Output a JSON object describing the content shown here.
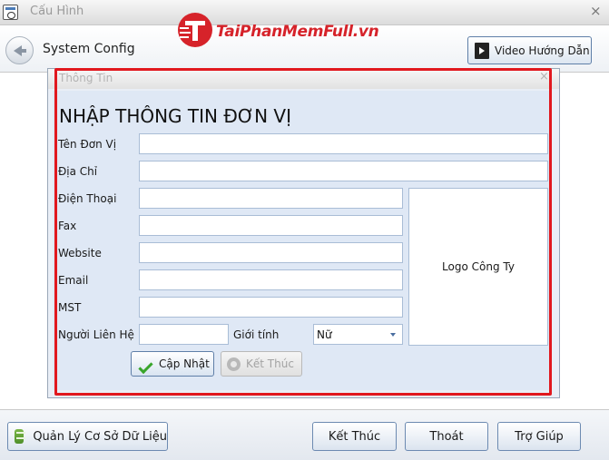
{
  "window": {
    "title": "Cấu Hình",
    "close_glyph": "×"
  },
  "toolbar": {
    "title": "System Config",
    "video_button_label": "Video Hướng Dẫn",
    "back_icon": "back-arrow-icon",
    "video_icon": "video-clapper-icon"
  },
  "watermark": {
    "text": "TaiPhanMemFull.vn",
    "color": "#d6232a"
  },
  "dialog": {
    "title": "Thông Tin",
    "close_glyph": "×",
    "heading": "NHẬP THÔNG TIN ĐƠN VỊ",
    "fields": {
      "ten_don_vi": {
        "label": "Tên Đơn Vị",
        "value": ""
      },
      "dia_chi": {
        "label": "Địa Chỉ",
        "value": ""
      },
      "dien_thoai": {
        "label": "Điện Thoại",
        "value": ""
      },
      "fax": {
        "label": "Fax",
        "value": ""
      },
      "website": {
        "label": "Website",
        "value": ""
      },
      "email": {
        "label": "Email",
        "value": ""
      },
      "mst": {
        "label": "MST",
        "value": ""
      },
      "nguoi_lien_he": {
        "label": "Người Liên Hệ",
        "value": ""
      },
      "gioi_tinh": {
        "label": "Giới tính",
        "value": "Nữ"
      }
    },
    "logo_label": "Logo Công Ty",
    "update_button_label": "Cập Nhật",
    "exit_button_label": "Kết Thúc",
    "highlight_color": "#e1181e"
  },
  "bottom_bar": {
    "db_button_label": "Quản Lý Cơ Sở Dữ Liệu",
    "end_button_label": "Kết Thúc",
    "quit_button_label": "Thoát",
    "help_button_label": "Trợ Giúp"
  }
}
